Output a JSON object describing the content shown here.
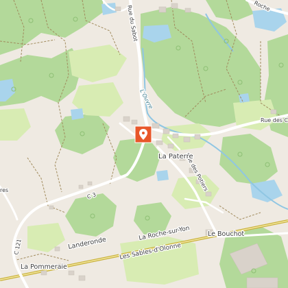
{
  "map": {
    "places": {
      "la_paterre": "La Paterre",
      "le_bouchot": "Le Bouchot",
      "la_pommeraie": "La Pommeraie",
      "landeronde": "Landeronde"
    },
    "roads": {
      "rue_du_sabot": "Rue du Sabot",
      "rue_des_potiers": "Rue des Potiers",
      "rue_des_c": "Rue des C",
      "roche_partial": "Roche",
      "c3": "C 3",
      "c121": "C 121",
      "res": "res"
    },
    "water": {
      "louvre": "L'Ouvre"
    },
    "railway": {
      "la_roche_sur_yon": "La Roche-sur-Yon",
      "les_sables": "Les Sables-d'Olonne"
    }
  },
  "marker": {
    "icon": "map-pin-icon",
    "color": "#e8572a"
  },
  "colors": {
    "land": "#efeae2",
    "forest": "#b3d99a",
    "meadow": "#d8ecb3",
    "water": "#a9d4ec",
    "road": "#ffffff",
    "building": "#d9d2ca",
    "railway": "#c9b23c"
  }
}
